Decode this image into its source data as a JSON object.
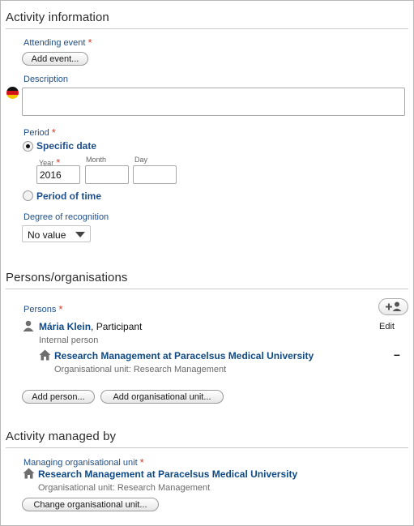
{
  "activity": {
    "title": "Activity information",
    "attending_label": "Attending event",
    "add_event_button": "Add event...",
    "description_label": "Description",
    "description_value": "",
    "period_label": "Period",
    "specific_date_label": "Specific date",
    "year_label": "Year",
    "month_label": "Month",
    "day_label": "Day",
    "year_value": "2016",
    "month_value": "",
    "day_value": "",
    "period_of_time_label": "Period of time",
    "recognition_label": "Degree of recognition",
    "recognition_value": "No value"
  },
  "persons": {
    "title": "Persons/organisations",
    "persons_label": "Persons",
    "person_name": "Mária Klein",
    "person_role": ", Participant",
    "edit_link": "Edit",
    "person_type": "Internal person",
    "org_name": "Research Management at Paracelsus Medical University",
    "org_detail": "Organisational unit: Research Management",
    "remove_symbol": "–",
    "add_person_button": "Add person...",
    "add_org_button": "Add organisational unit..."
  },
  "managed": {
    "title": "Activity managed by",
    "managing_label": "Managing organisational unit",
    "org_name": "Research Management at Paracelsus Medical University",
    "org_detail": "Organisational unit: Research Management",
    "change_button": "Change organisational unit..."
  },
  "required_marker": "*",
  "colors": {
    "label_blue": "#1d4e89",
    "link_blue": "#0f4a86",
    "required_red": "#d23a2a"
  },
  "icons": {
    "flag": "german-flag-icon",
    "add_person": "add-person-icon",
    "person": "person-icon",
    "org": "house-icon"
  }
}
